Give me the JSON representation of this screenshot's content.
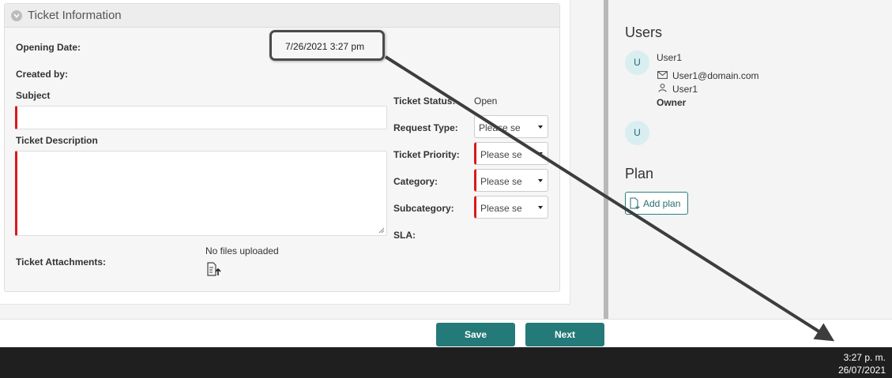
{
  "panel": {
    "title": "Ticket Information",
    "opening_date_label": "Opening Date:",
    "opening_date_value": "7/26/2021 3:27 pm",
    "created_by_label": "Created by:",
    "subject_label": "Subject",
    "description_label": "Ticket Description",
    "attachments_label": "Ticket Attachments:",
    "no_files": "No files uploaded",
    "status_label": "Ticket Status:",
    "status_value": "Open",
    "request_type_label": "Request Type:",
    "priority_label": "Ticket Priority:",
    "category_label": "Category:",
    "subcategory_label": "Subcategory:",
    "sla_label": "SLA:",
    "select_placeholder": "Please se"
  },
  "right": {
    "users_title": "Users",
    "user1_avatar": "U",
    "user1_name": "User1",
    "user1_email": "User1@domain.com",
    "user1_username": "User1",
    "user1_role": "Owner",
    "user2_avatar": "U",
    "plan_title": "Plan",
    "add_plan_label": "Add plan"
  },
  "footer": {
    "save_label": "Save",
    "next_label": "Next"
  },
  "taskbar": {
    "time": "3:27 p. m.",
    "date": "26/07/2021"
  },
  "colors": {
    "accent": "#247a78",
    "required": "#d81a1a",
    "taskbar": "#1f1f1f"
  }
}
